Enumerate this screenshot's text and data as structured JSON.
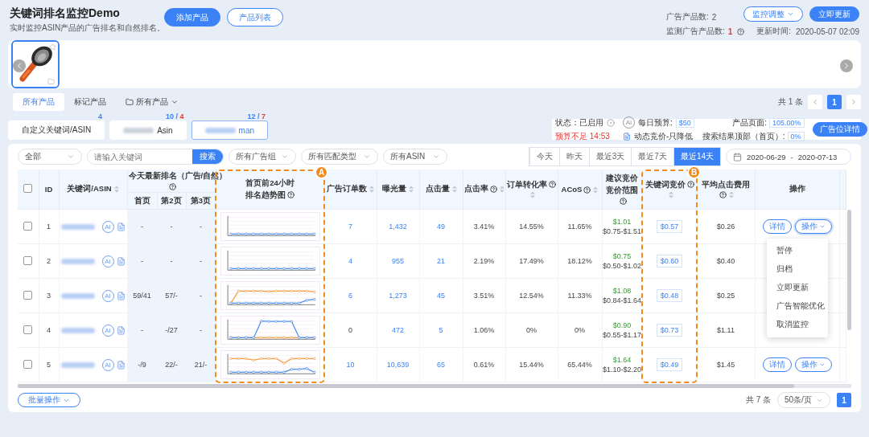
{
  "header": {
    "title": "关键词排名监控Demo",
    "subtitle": "实时监控ASIN产品的广告排名和自然排名。",
    "buttons": [
      {
        "label": "添加产品",
        "primary": true
      },
      {
        "label": "产品列表",
        "primary": false
      }
    ],
    "stats": [
      {
        "label": "广告产品数:",
        "value": "2",
        "alert": false,
        "help": false
      },
      {
        "label": "监测广告产品数:",
        "value": "1",
        "alert": true,
        "help": true
      }
    ],
    "adjust_button": "监控调整",
    "update_button": "立即更新",
    "update_time": {
      "label": "更新时间:",
      "value": "2020-05-07 02:09"
    }
  },
  "product_strip": {
    "products": [
      {
        "kind": "picture",
        "selected": true
      }
    ]
  },
  "product_tabs": [
    {
      "label": "所有产品",
      "kind": "tab",
      "selected": true
    },
    {
      "label": "标记产品",
      "kind": "tab",
      "selected": false
    },
    {
      "label": "所有产品",
      "kind": "folder",
      "selected": false
    }
  ],
  "top_pagination": {
    "total": "共 1 条",
    "pages": [
      {
        "label": "1",
        "selected": true
      }
    ]
  },
  "keyword_groups": [
    {
      "label": "自定义关键词/ASIN",
      "count": "4",
      "selected": false,
      "redacted": false
    },
    {
      "label": "Asin",
      "count": "10",
      "separator": "/",
      "alert_count": "4",
      "selected": false,
      "redacted": true
    },
    {
      "label": "man",
      "count": "12",
      "separator": "/",
      "alert_count": "7",
      "selected": true,
      "redacted": true
    }
  ],
  "campaign_panel": {
    "status": "状态：已启用",
    "warning": "预算不足 14:53",
    "ai": "AI",
    "budget_label": "每日预算:",
    "budget": "$50",
    "bidding": "动态竞价-只降低",
    "placements": [
      {
        "label": "产品页面:",
        "value": "105.00%"
      },
      {
        "label": "搜索结果顶部（首页）:",
        "value": "0%"
      }
    ],
    "detail_button": "广告位详情"
  },
  "filters": {
    "scope": "全部",
    "search_placeholder": "请输入关键词",
    "search_button": "搜索",
    "selects": [
      "所有广告组",
      "所有匹配类型",
      "所有ASIN"
    ],
    "ranges": [
      {
        "label": "今天",
        "selected": false
      },
      {
        "label": "昨天",
        "selected": false
      },
      {
        "label": "最近3天",
        "selected": false
      },
      {
        "label": "最近7天",
        "selected": false
      },
      {
        "label": "最近14天",
        "selected": true
      }
    ],
    "date_range": {
      "start": "2020-06-29",
      "separator": "-",
      "end": "2020-07-13"
    }
  },
  "table": {
    "columns": [
      {
        "kind": "checkbox",
        "checked": false
      },
      {
        "kind": "plain",
        "label": "ID",
        "sortable": false,
        "help": false
      },
      {
        "kind": "plain",
        "label": "关键词/ASIN",
        "sortable": true,
        "help": false
      },
      {
        "kind": "group",
        "label": "今天最新排名（广告/自然）",
        "help": true,
        "children": [
          "首页",
          "第2页",
          "第3页"
        ]
      },
      {
        "kind": "chart",
        "label": "首页前24小时",
        "sublabel": "排名趋势图",
        "help": true,
        "callout": "A"
      },
      {
        "kind": "plain",
        "label": "广告订单数",
        "sortable": true,
        "help": false
      },
      {
        "kind": "plain",
        "label": "曝光量",
        "sortable": true,
        "help": false
      },
      {
        "kind": "plain",
        "label": "点击量",
        "sortable": true,
        "help": false
      },
      {
        "kind": "plain",
        "label": "点击率",
        "sortable": true,
        "help": true
      },
      {
        "kind": "plain",
        "label": "订单转化率",
        "sortable": true,
        "help": true
      },
      {
        "kind": "plain",
        "label": "ACoS",
        "sortable": true,
        "help": true
      },
      {
        "kind": "stacked",
        "label": "建议竞价",
        "sublabel": "竞价范围",
        "help": true
      },
      {
        "kind": "plain",
        "label": "关键词竞价",
        "sortable": true,
        "help": true,
        "callout": "B"
      },
      {
        "kind": "plain",
        "label": "平均点击费用",
        "sortable": true,
        "help": true
      },
      {
        "kind": "plain",
        "label": "操作",
        "sortable": false,
        "help": false
      }
    ],
    "rows": [
      {
        "checked": false,
        "id": "1",
        "ai": "AI",
        "ranks": [
          "-",
          "-",
          "-"
        ],
        "trend": {
          "kind": "flat"
        },
        "orders": "7",
        "orders_linked": true,
        "impressions": "1,432",
        "clicks": "49",
        "ctr": "3.41%",
        "cvr": "14.55%",
        "acos": "11.65%",
        "suggested_bid": "$1.01",
        "bid_range": "$0.75-$1.51",
        "bid": "$0.57",
        "cpc": "$0.26",
        "actions": [
          {
            "label": "详情",
            "kind": "plain"
          },
          {
            "label": "操作",
            "kind": "dropdown"
          }
        ],
        "menu": [
          "暂停",
          "归档",
          "立即更新",
          "广告智能优化",
          "取消监控"
        ]
      },
      {
        "checked": false,
        "id": "2",
        "ai": "AI",
        "ranks": [
          "-",
          "-",
          "-"
        ],
        "trend": {
          "kind": "flat"
        },
        "orders": "4",
        "orders_linked": true,
        "impressions": "955",
        "clicks": "21",
        "ctr": "2.19%",
        "cvr": "17.49%",
        "acos": "18.12%",
        "suggested_bid": "$0.75",
        "bid_range": "$0.50-$1.02",
        "bid": "$0.60",
        "cpc": "$0.40"
      },
      {
        "checked": false,
        "id": "3",
        "ai": "AI",
        "ranks": [
          "59/41",
          "57/-",
          "-"
        ],
        "trend": {
          "kind": "orange_high"
        },
        "orders": "6",
        "orders_linked": true,
        "impressions": "1,273",
        "clicks": "45",
        "ctr": "3.51%",
        "cvr": "12.54%",
        "acos": "11.33%",
        "suggested_bid": "$1.08",
        "bid_range": "$0.84-$1.64",
        "bid": "$0.48",
        "cpc": "$0.25"
      },
      {
        "checked": false,
        "id": "4",
        "ai": "AI",
        "ranks": [
          "-",
          "-/27",
          "-"
        ],
        "trend": {
          "kind": "blue_plateau"
        },
        "orders": "0",
        "orders_linked": false,
        "impressions": "472",
        "clicks": "5",
        "ctr": "1.06%",
        "cvr": "0%",
        "acos": "0%",
        "suggested_bid": "$0.90",
        "bid_range": "$0.55-$1.17",
        "bid": "$0.73",
        "cpc": "$1.11"
      },
      {
        "checked": false,
        "id": "5",
        "ai": "AI",
        "ranks": [
          "-/9",
          "22/-",
          "21/-"
        ],
        "trend": {
          "kind": "mixed"
        },
        "orders": "10",
        "orders_linked": true,
        "impressions": "10,639",
        "clicks": "65",
        "ctr": "0.61%",
        "cvr": "15.44%",
        "acos": "65.44%",
        "suggested_bid": "$1.64",
        "bid_range": "$1.10-$2.20",
        "bid": "$0.49",
        "cpc": "$1.45",
        "actions": [
          {
            "label": "详情",
            "kind": "plain"
          },
          {
            "label": "操作",
            "kind": "dropdown"
          }
        ]
      }
    ]
  },
  "footer": {
    "batch_button": "批量操作",
    "total": "共 7 条",
    "page_size": "50条/页",
    "pages": [
      {
        "label": "1",
        "selected": true
      }
    ]
  }
}
